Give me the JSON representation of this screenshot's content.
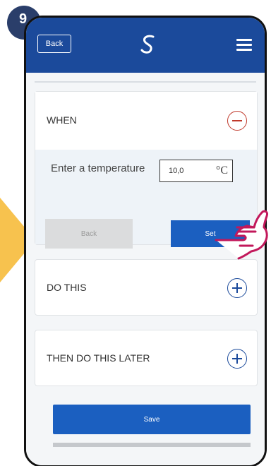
{
  "step_number": "9",
  "header": {
    "back_label": "Back"
  },
  "when": {
    "label": "WHEN",
    "temperature_label": "Enter a temperature",
    "temperature_value": "10,0",
    "temperature_unit": "°C",
    "back_button": "Back",
    "set_button": "Set"
  },
  "do_this": {
    "label": "DO THIS"
  },
  "then_later": {
    "label": "THEN DO THIS LATER"
  },
  "save_button": "Save",
  "colors": {
    "header_blue": "#1b4a9b",
    "button_blue": "#1b5fc0",
    "minus_red": "#c0392b",
    "plus_blue": "#1b4a9b",
    "pointer_magenta": "#c2185b",
    "arrow_yellow": "#f7c24e",
    "badge_navy": "#2a3e6a"
  },
  "icons": {
    "logo": "salus-logo-icon",
    "menu": "hamburger-menu-icon",
    "collapse": "minus-circle-icon",
    "expand": "plus-circle-icon",
    "pointer": "hand-pointer-icon"
  }
}
